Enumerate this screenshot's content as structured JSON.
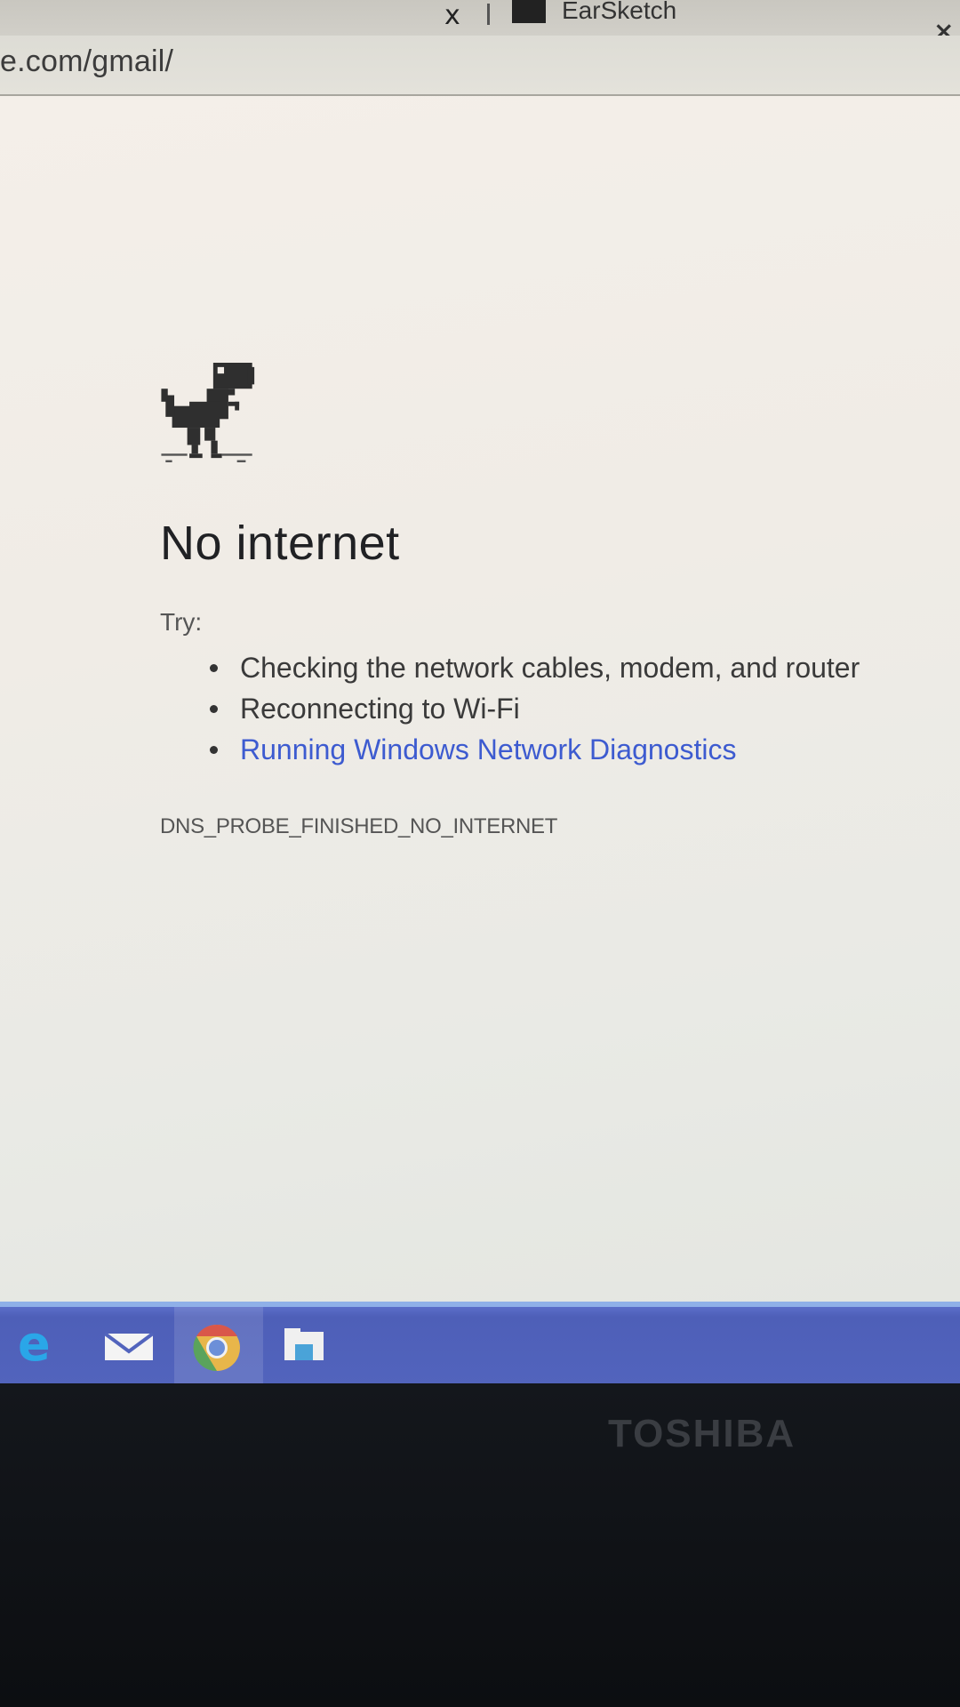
{
  "browser": {
    "tab_title": "EarSketch",
    "tab_close_glyph": "x",
    "window_close_glyph": "×",
    "url": "e.com/gmail/"
  },
  "page": {
    "heading": "No internet",
    "try_label": "Try:",
    "suggestions": [
      "Checking the network cables, modem, and router",
      "Reconnecting to Wi-Fi",
      "Running Windows Network Diagnostics"
    ],
    "error_code": "DNS_PROBE_FINISHED_NO_INTERNET",
    "icon": "dino-icon",
    "link_color": "#3d5bd0"
  },
  "taskbar": {
    "apps": [
      "edge-icon",
      "mail-icon",
      "chrome-icon",
      "file-explorer-icon"
    ],
    "active_app": "chrome-icon",
    "color": "#5264bd"
  },
  "bezel": {
    "brand": "TOSHIBA"
  }
}
